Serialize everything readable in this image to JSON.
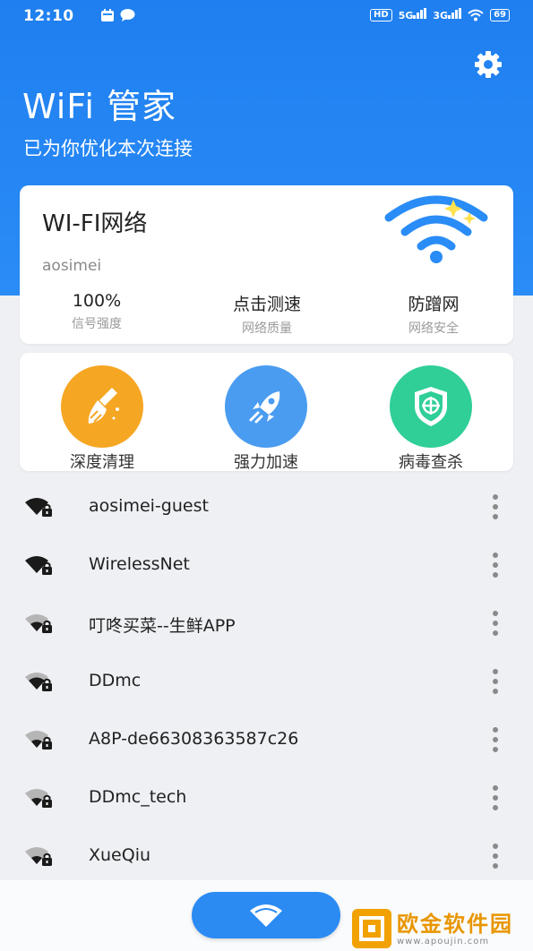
{
  "status_bar": {
    "time": "12:10",
    "network_badges": [
      "HD",
      "5G",
      "3G"
    ],
    "battery": "69"
  },
  "header": {
    "title": "WiFi 管家",
    "subtitle": "已为你优化本次连接",
    "settings_icon": "gear-icon"
  },
  "wifi_card": {
    "title": "WI-FI网络",
    "ssid": "aosimei",
    "stats": [
      {
        "value": "100%",
        "label": "信号强度"
      },
      {
        "value": "点击测速",
        "label": "网络质量"
      },
      {
        "value": "防蹭网",
        "label": "网络安全"
      }
    ]
  },
  "tools": [
    {
      "label": "深度清理",
      "icon": "broom-icon",
      "color": "#f5a623"
    },
    {
      "label": "强力加速",
      "icon": "rocket-icon",
      "color": "#4a9cf0"
    },
    {
      "label": "病毒查杀",
      "icon": "shield-icon",
      "color": "#2fcf97"
    }
  ],
  "networks": [
    {
      "name": "aosimei-guest",
      "strength": "strong"
    },
    {
      "name": "WirelessNet",
      "strength": "strong"
    },
    {
      "name": "叮咚买菜--生鲜APP",
      "strength": "weak"
    },
    {
      "name": "DDmc",
      "strength": "medium"
    },
    {
      "name": "A8P-de66308363587c26",
      "strength": "weak"
    },
    {
      "name": "DDmc_tech",
      "strength": "weak"
    },
    {
      "name": "XueQiu",
      "strength": "weak"
    }
  ],
  "watermark": {
    "text": "欧金软件园",
    "url": "www.apoujin.com"
  },
  "colors": {
    "primary": "#2a8cf6",
    "background": "#eef0f4"
  }
}
